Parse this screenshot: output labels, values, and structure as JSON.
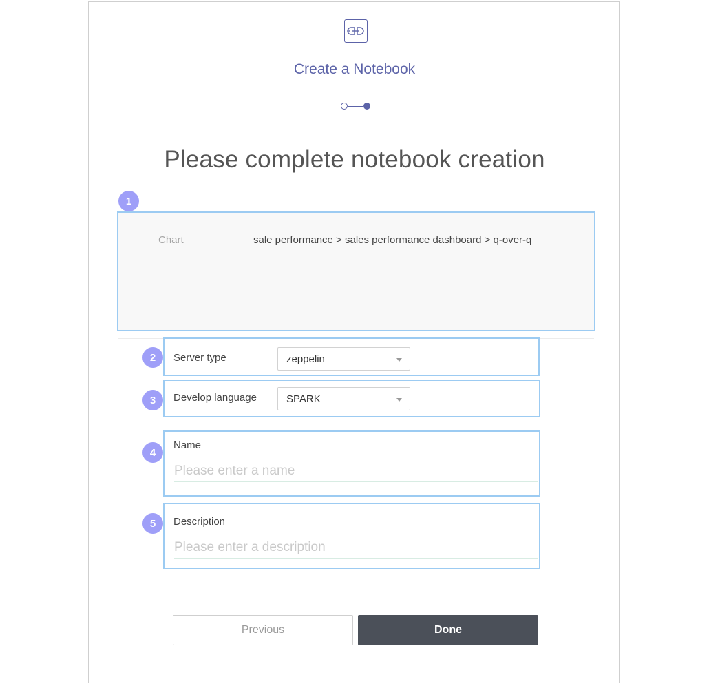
{
  "header": {
    "title": "Create a Notebook",
    "logo_icon": "notebook-plug-icon",
    "steps": [
      {
        "state": "completed"
      },
      {
        "state": "current"
      }
    ]
  },
  "heading": "Please complete notebook creation",
  "badges": [
    "1",
    "2",
    "3",
    "4",
    "5"
  ],
  "chart": {
    "label": "Chart",
    "value": "sale performance > sales performance dashboard > q-over-q"
  },
  "server_type": {
    "label": "Server type",
    "selected": "zeppelin"
  },
  "develop_language": {
    "label": "Develop language",
    "selected": "SPARK"
  },
  "name": {
    "label": "Name",
    "value": "",
    "placeholder": "Please enter a name"
  },
  "description": {
    "label": "Description",
    "value": "",
    "placeholder": "Please enter a description"
  },
  "buttons": {
    "previous": "Previous",
    "done": "Done"
  },
  "colors": {
    "accent": "#5c63a8",
    "badge": "#9f9ff8",
    "highlight_border": "#9ccbf2",
    "done_button": "#4b5059"
  }
}
